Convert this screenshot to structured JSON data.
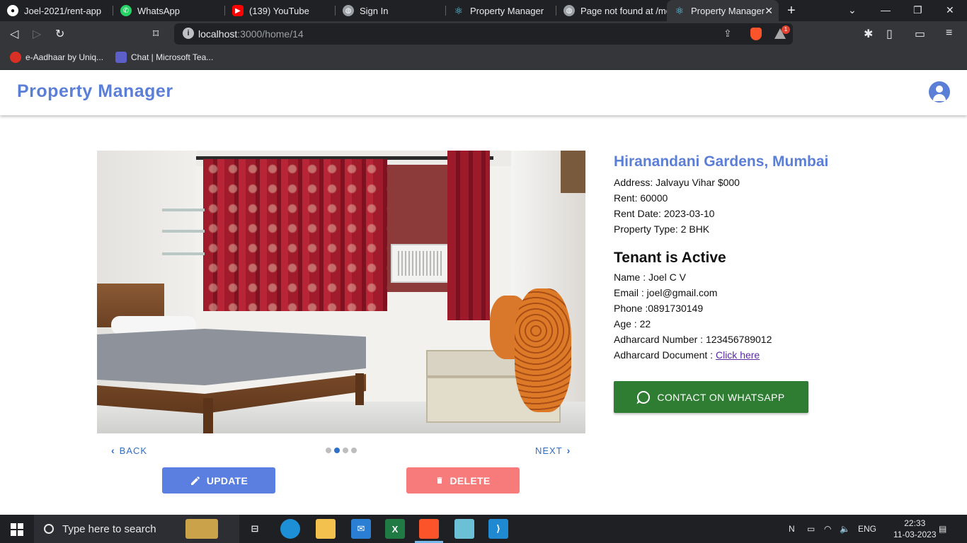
{
  "browser": {
    "tabs": [
      {
        "title": "Joel-2021/rent-app",
        "icon": "github-icon",
        "active": false
      },
      {
        "title": "WhatsApp",
        "icon": "whatsapp-icon",
        "active": false
      },
      {
        "title": "(139) YouTube",
        "icon": "youtube-icon",
        "active": false
      },
      {
        "title": "Sign In",
        "icon": "globe-icon",
        "active": false
      },
      {
        "title": "Property Manager",
        "icon": "react-icon",
        "active": false
      },
      {
        "title": "Page not found at /me",
        "icon": "globe-icon",
        "active": false
      },
      {
        "title": "Property Manager",
        "icon": "react-icon",
        "active": true
      }
    ],
    "url_host": "localhost",
    "url_rest": ":3000/home/14",
    "rewards_badge": "1",
    "bookmarks": [
      {
        "label": "e-Aadhaar by Uniq...",
        "icon": "aadhaar-icon"
      },
      {
        "label": "Chat | Microsoft Tea...",
        "icon": "teams-icon"
      }
    ]
  },
  "app": {
    "brand": "Property Manager",
    "carousel": {
      "back_label": "BACK",
      "next_label": "NEXT",
      "dot_count": 4,
      "active_dot": 1
    },
    "actions": {
      "update_label": "UPDATE",
      "delete_label": "DELETE"
    },
    "property": {
      "title": "Hiranandani Gardens, Mumbai",
      "address": "Address: Jalvayu Vihar $000",
      "rent": "Rent: 60000",
      "rent_date": "Rent Date: 2023-03-10",
      "type": "Property Type: 2 BHK"
    },
    "tenant": {
      "heading": "Tenant is Active",
      "name": "Name : Joel C V",
      "email": "Email : joel@gmail.com",
      "phone": "Phone :0891730149",
      "age": "Age : 22",
      "adhar_number": "Adharcard Number : 123456789012",
      "adhar_doc_label": "Adharcard Document : ",
      "adhar_doc_link": "Click here"
    },
    "whatsapp_label": "CONTACT ON WHATSAPP",
    "colors": {
      "brand": "#5b7fd6",
      "update": "#5b7fe0",
      "delete": "#f77b7b",
      "whatsapp": "#2e7d32",
      "link": "#2f6fc8"
    }
  },
  "taskbar": {
    "search_placeholder": "Type here to search",
    "language": "ENG",
    "time": "22:33",
    "date": "11-03-2023"
  }
}
